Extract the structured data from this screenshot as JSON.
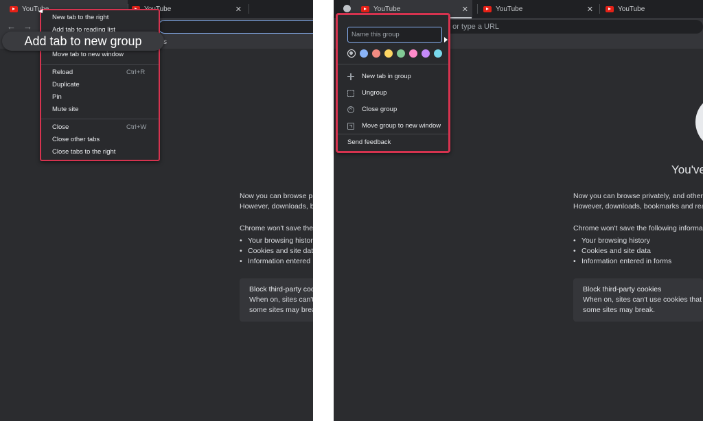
{
  "left": {
    "tabs": [
      {
        "label": "YouTube"
      },
      {
        "label": "YouTube"
      }
    ],
    "context_menu": {
      "items_group1": [
        {
          "label": "New tab to the right"
        },
        {
          "label": "Add tab to reading list"
        },
        {
          "label": "Move tab to new window"
        }
      ],
      "items_group2": [
        {
          "label": "Reload",
          "shortcut": "Ctrl+R"
        },
        {
          "label": "Duplicate"
        },
        {
          "label": "Pin"
        },
        {
          "label": "Mute site"
        }
      ],
      "items_group3": [
        {
          "label": "Close",
          "shortcut": "Ctrl+W"
        },
        {
          "label": "Close other tabs"
        },
        {
          "label": "Close tabs to the right"
        }
      ]
    },
    "callout": "Add tab to new group",
    "bookmark_fragment": "s",
    "incognito": {
      "line1": "Now you can browse pr",
      "line2": "However, downloads, bo",
      "wont_save": "Chrome won't save the",
      "bullets": [
        "Your browsing histor",
        "Cookies and site dat",
        "Information entered"
      ],
      "cookie_title": "Block third-party coo",
      "cookie_line1": "When on, sites can't",
      "cookie_line2": "some sites may breal"
    }
  },
  "right": {
    "tabs": [
      {
        "label": "YouTube"
      },
      {
        "label": "YouTube"
      },
      {
        "label": "YouTube"
      }
    ],
    "omnibox_text": "e or type a URL",
    "group_editor": {
      "name_placeholder": "Name this group",
      "colors": [
        "#bdc1c6",
        "#8ab4f8",
        "#f28b82",
        "#fdd663",
        "#81c995",
        "#ff8bcb",
        "#c58af9",
        "#78d9ec"
      ],
      "selected_color_index": 0,
      "items": [
        {
          "label": "New tab in group",
          "icon": "plus-icon"
        },
        {
          "label": "Ungroup",
          "icon": "ungroup-icon"
        },
        {
          "label": "Close group",
          "icon": "close-circle-icon"
        },
        {
          "label": "Move group to new window",
          "icon": "move-window-icon"
        }
      ],
      "send_feedback": "Send feedback"
    },
    "incognito": {
      "heading_fragment": "You've",
      "line1": "Now you can browse privately, and other",
      "line2": "However, downloads, bookmarks and rea",
      "wont_save": "Chrome won't save the following informa",
      "bullets": [
        "Your browsing history",
        "Cookies and site data",
        "Information entered in forms"
      ],
      "cookie_title": "Block third-party cookies",
      "cookie_line1": "When on, sites can't use cookies that y",
      "cookie_line2": "some sites may break."
    }
  }
}
